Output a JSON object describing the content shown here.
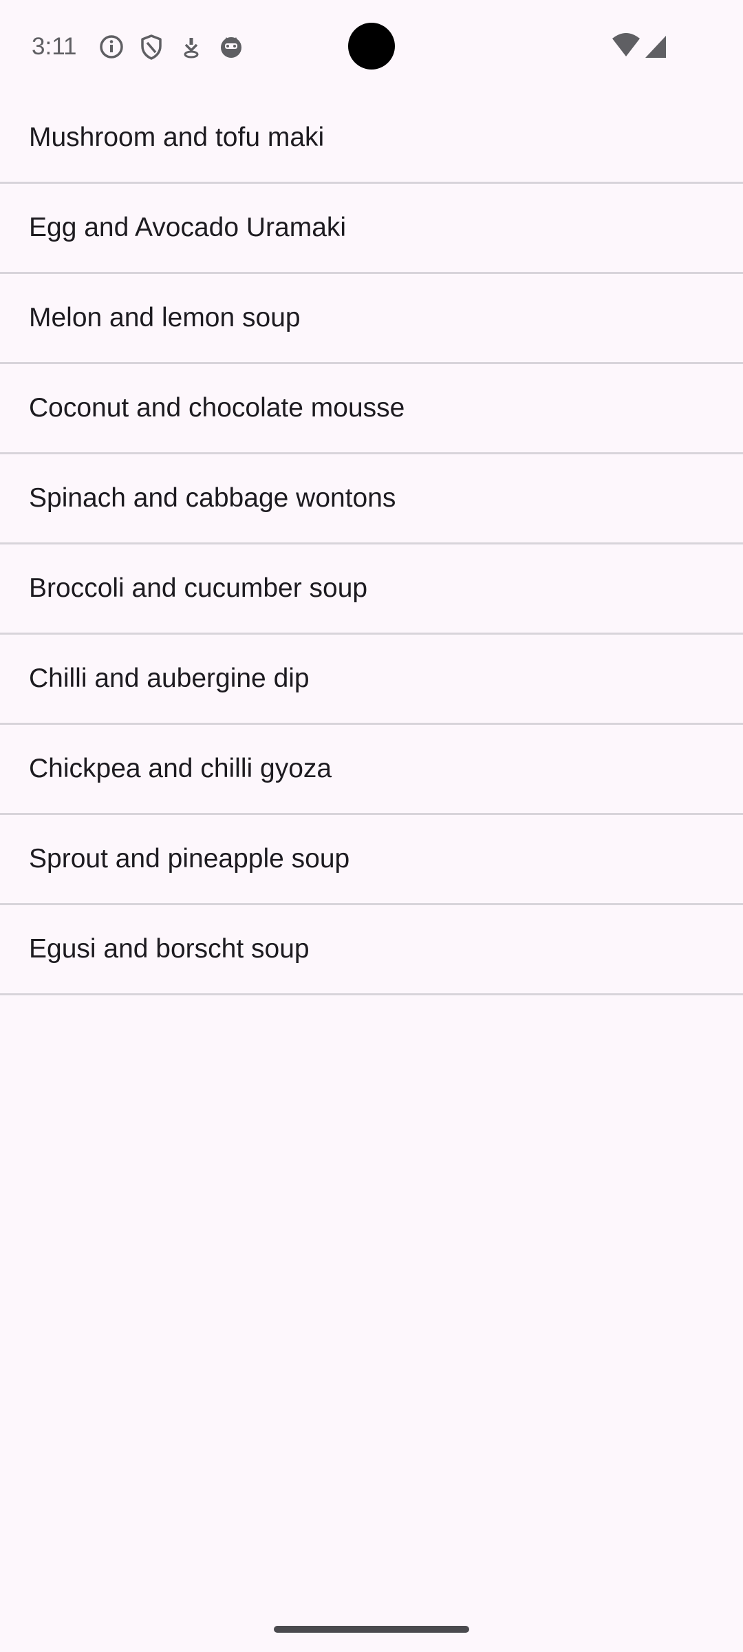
{
  "status_bar": {
    "time": "3:11",
    "icons": [
      "info-icon",
      "shield-icon",
      "download-icon",
      "cat-face-icon",
      "wifi-icon",
      "cellular-signal-icon"
    ]
  },
  "recipes": [
    {
      "label": "Mushroom and tofu maki"
    },
    {
      "label": "Egg and Avocado Uramaki"
    },
    {
      "label": "Melon and lemon soup"
    },
    {
      "label": "Coconut and chocolate mousse"
    },
    {
      "label": "Spinach and cabbage wontons"
    },
    {
      "label": "Broccoli and cucumber soup"
    },
    {
      "label": "Chilli and aubergine dip"
    },
    {
      "label": "Chickpea and chilli gyoza"
    },
    {
      "label": "Sprout and pineapple soup"
    },
    {
      "label": "Egusi and borscht soup"
    }
  ],
  "colors": {
    "background": "#fdf7fc",
    "divider": "#d8d4da",
    "text": "#1d1b20"
  }
}
